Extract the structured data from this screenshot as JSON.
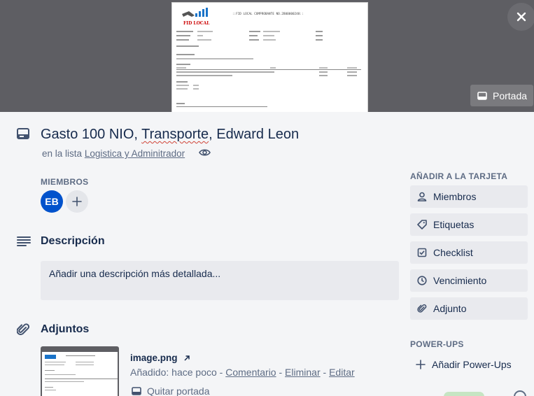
{
  "cover": {
    "document_title": "::FID LOCAL COMPROBANTE NO.2B00000248::",
    "logo_text": "FID LOCAL",
    "portada_label": "Portada"
  },
  "header": {
    "title_parts": [
      "Gasto 100 NIO, ",
      "Transporte",
      ", Edward Leon"
    ],
    "in_list_prefix": "en la lista",
    "list_name": "Logistica y Adminitrador"
  },
  "members": {
    "label": "MIEMBROS",
    "avatar_initials": "EB",
    "avatar_color": "#0052cc"
  },
  "description": {
    "title": "Descripción",
    "placeholder": "Añadir una descripción más detallada..."
  },
  "attachments": {
    "title": "Adjuntos",
    "items": [
      {
        "name": "image.png",
        "added": "Añadido: hace poco",
        "sep": " - ",
        "comment": "Comentario",
        "delete": "Eliminar",
        "edit": "Editar",
        "remove_cover": "Quitar portada"
      }
    ]
  },
  "sidebar": {
    "add_label": "AÑADIR A LA TARJETA",
    "buttons": [
      {
        "label": "Miembros",
        "icon": "person-icon"
      },
      {
        "label": "Etiquetas",
        "icon": "tag-icon"
      },
      {
        "label": "Checklist",
        "icon": "checklist-icon"
      },
      {
        "label": "Vencimiento",
        "icon": "clock-icon"
      },
      {
        "label": "Adjunto",
        "icon": "paperclip-icon"
      }
    ],
    "powerups_label": "POWER-UPS",
    "add_powerups": "Añadir Power-Ups"
  },
  "colors": {
    "background": "#f4f5f7",
    "cover_bg": "#5e5e63",
    "button_bg": "#e9eaee",
    "text_primary": "#172b4d",
    "text_secondary": "#5e6c84"
  }
}
